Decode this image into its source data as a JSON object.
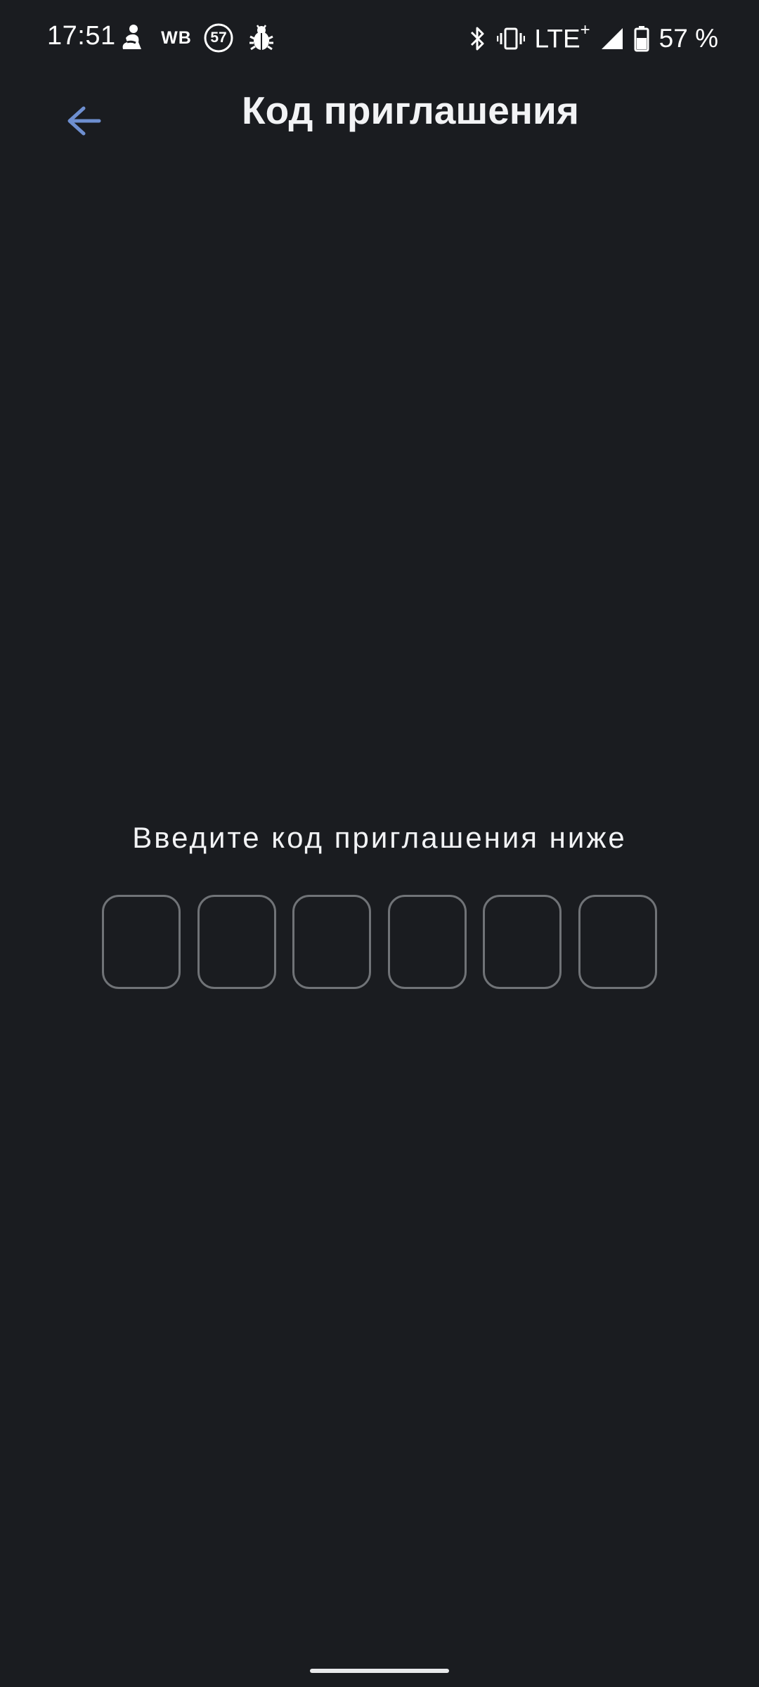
{
  "status_bar": {
    "time": "17:51",
    "wb_label": "WB",
    "badge_count": "57",
    "network_label": "LTE",
    "network_suffix": "+",
    "battery_label": "57 %",
    "icons": [
      "person-pin-icon",
      "wb-icon",
      "counter-badge-icon",
      "bug-icon",
      "bluetooth-icon",
      "vibrate-icon",
      "signal-icon",
      "battery-icon"
    ]
  },
  "header": {
    "title": "Код приглашения",
    "back_icon": "arrow-left-icon"
  },
  "main": {
    "prompt": "Введите код приглашения ниже",
    "code_length": 6
  },
  "colors": {
    "background": "#1a1c20",
    "accent": "#6e8fd0",
    "box_border": "#707377",
    "text": "#f2f3f5"
  }
}
